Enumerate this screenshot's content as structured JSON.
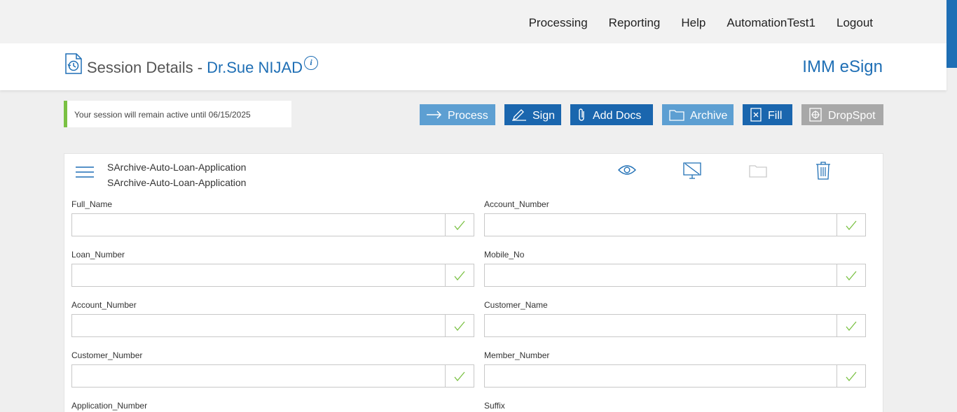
{
  "nav": {
    "items": [
      "Processing",
      "Reporting",
      "Help",
      "AutomationTest1",
      "Logout"
    ]
  },
  "header": {
    "title": "Session Details -",
    "signer_name": "Dr.Sue NIJAD",
    "brand": "IMM eSign"
  },
  "session": {
    "message": "Your session will remain active until 06/15/2025"
  },
  "toolbar": {
    "process": "Process",
    "sign": "Sign",
    "add_docs": "Add Docs",
    "archive": "Archive",
    "fill": "Fill",
    "dropspot": "DropSpot"
  },
  "colors": {
    "accent": "#1f6fb5",
    "button_light": "#5d9fd2",
    "button_dark": "#1a66ae",
    "button_disabled": "#a8a8a8",
    "success": "#7ac143"
  },
  "document": {
    "name_line1": "SArchive-Auto-Loan-Application",
    "name_line2": "SArchive-Auto-Loan-Application",
    "actions": [
      "eye-icon",
      "monitor-off-icon",
      "folder-icon",
      "trash-icon"
    ]
  },
  "fields": {
    "full_name": {
      "label": "Full_Name",
      "value": ""
    },
    "account_number_r": {
      "label": "Account_Number",
      "value": ""
    },
    "loan_number": {
      "label": "Loan_Number",
      "value": ""
    },
    "mobile_no": {
      "label": "Mobile_No",
      "value": ""
    },
    "account_number_l": {
      "label": "Account_Number",
      "value": ""
    },
    "customer_name": {
      "label": "Customer_Name",
      "value": ""
    },
    "customer_number": {
      "label": "Customer_Number",
      "value": ""
    },
    "member_number": {
      "label": "Member_Number",
      "value": ""
    },
    "application_number": {
      "label": "Application_Number"
    },
    "suffix": {
      "label": "Suffix"
    }
  }
}
